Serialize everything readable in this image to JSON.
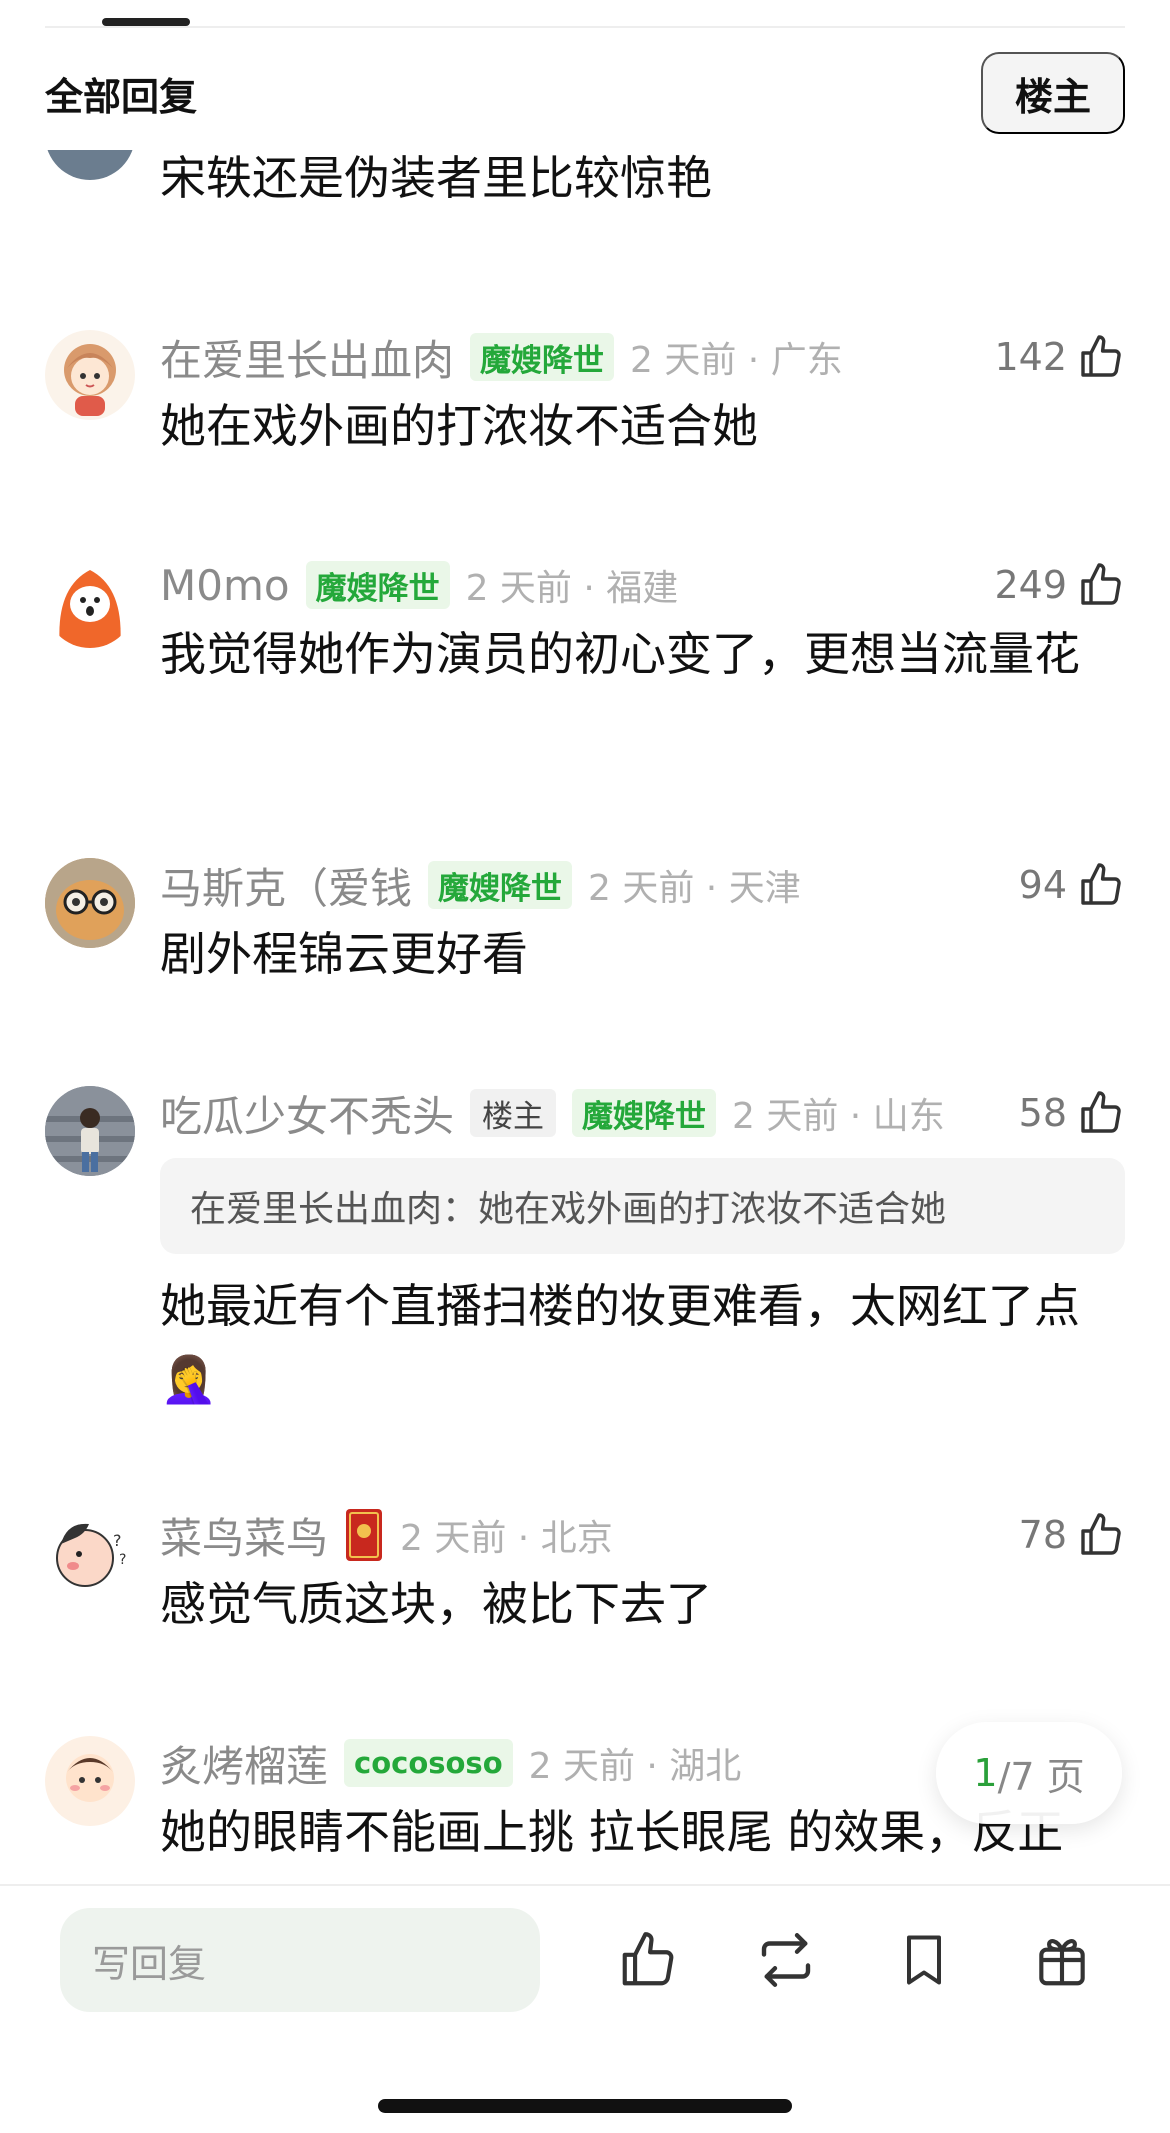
{
  "header": {
    "title": "全部回复",
    "op_filter": "楼主"
  },
  "partial_top_comment": {
    "text": "宋轶还是伪装者里比较惊艳"
  },
  "comments": [
    {
      "username": "在爱里长出血肉",
      "badges": [
        "魔嫂降世"
      ],
      "timeloc": "2 天前 · 广东",
      "likes": "142",
      "text": "她在戏外画的打浓妆不适合她"
    },
    {
      "username": "M0mo",
      "badges": [
        "魔嫂降世"
      ],
      "timeloc": "2 天前 · 福建",
      "likes": "249",
      "text": "我觉得她作为演员的初心变了，更想当流量花"
    },
    {
      "username": "马斯克（爱钱",
      "badges": [
        "魔嫂降世"
      ],
      "timeloc": "2 天前 · 天津",
      "likes": "94",
      "text": "剧外程锦云更好看"
    },
    {
      "username": "吃瓜少女不秃头",
      "op_badge": "楼主",
      "badges": [
        "魔嫂降世"
      ],
      "timeloc": "2 天前 · 山东",
      "likes": "58",
      "quote": "在爱里长出血肉：她在戏外画的打浓妆不适合她",
      "text": "她最近有个直播扫楼的妆更难看，太网红了点🤦‍♀️"
    },
    {
      "username": "菜鸟菜鸟",
      "timeloc": "2 天前 · 北京",
      "likes": "78",
      "text": "感觉气质这块，被比下去了"
    },
    {
      "username": "炙烤榴莲",
      "badges": [
        "cocososo"
      ],
      "timeloc": "2 天前 · 湖北",
      "text": "她的眼睛不能画上挑 拉长眼尾 的效果，反正"
    }
  ],
  "pagination": {
    "current": "1",
    "total": "/7 页"
  },
  "bottom_bar": {
    "reply_placeholder": "写回复"
  },
  "colors": {
    "badge_green": "#24a83a",
    "badge_bg": "#eaf7e8",
    "meta_gray": "#8a8a8a"
  }
}
